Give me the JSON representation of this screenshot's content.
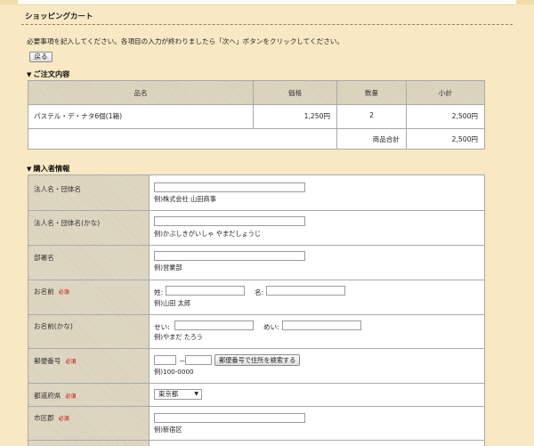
{
  "page": {
    "title": "ショッピングカート",
    "instructions": "必要事項を記入してください。各項目の入力が終わりましたら「次へ」ボタンをクリックしてください。",
    "back_button": "戻る"
  },
  "order": {
    "heading": "ご注文内容",
    "columns": [
      "品名",
      "価格",
      "数量",
      "小計"
    ],
    "items": [
      {
        "name": "パステル・デ・ナタ6個(1箱)",
        "price": "1,250円",
        "qty": "2",
        "subtotal": "2,500円"
      }
    ],
    "total_label": "商品合計",
    "total_value": "2,500円"
  },
  "buyer": {
    "heading": "購入者情報",
    "required_mark": "必須",
    "fields": {
      "company": {
        "label": "法人名・団体名",
        "value": "",
        "example": "例)株式会社 山田商事"
      },
      "company_kana": {
        "label": "法人名・団体名(かな)",
        "value": "",
        "example": "例)かぶしきがいしゃ やまだしょうじ"
      },
      "department": {
        "label": "部署名",
        "value": "",
        "example": "例)営業部"
      },
      "name": {
        "label": "お名前",
        "last_label": "姓:",
        "first_label": "名:",
        "last_value": "",
        "first_value": "",
        "example": "例)山田 太郎"
      },
      "name_kana": {
        "label": "お名前(かな)",
        "last_label": "せい:",
        "first_label": "めい:",
        "last_value": "",
        "first_value": "",
        "example": "例)やまだ たろう"
      },
      "postal": {
        "label": "郵便番号",
        "part1": "",
        "part2": "",
        "separator": "－",
        "search_button": "郵便番号で住所を検索する",
        "example": "例)100-0000"
      },
      "prefecture": {
        "label": "都道府県",
        "selected": "東京都"
      },
      "city": {
        "label": "市区郡",
        "value": "",
        "example": "例)新宿区"
      }
    }
  }
}
